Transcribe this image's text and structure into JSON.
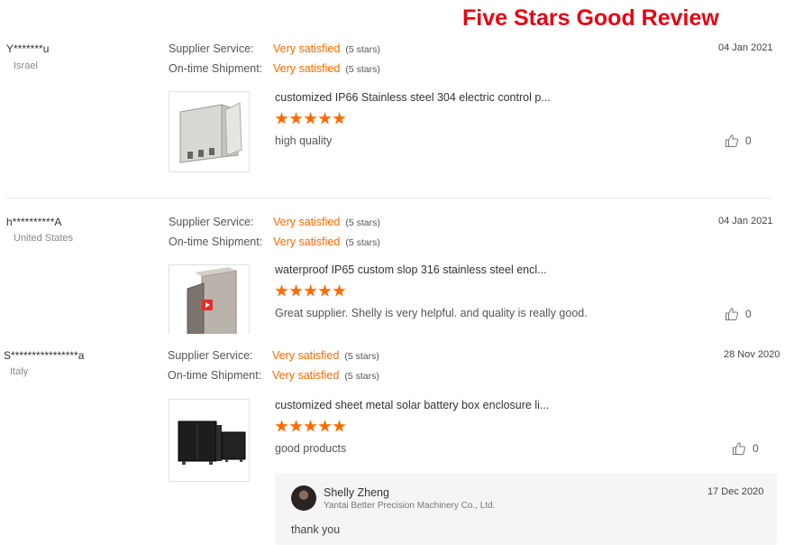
{
  "banner": "Five Stars Good Review",
  "reviews": [
    {
      "user": "Y*******u",
      "country": "Israel",
      "supplier_label": "Supplier Service:",
      "supplier_value": "Very satisfied",
      "supplier_stars": "(5 stars)",
      "shipment_label": "On-time Shipment:",
      "shipment_value": "Very satisfied",
      "shipment_stars": "(5 stars)",
      "date": "04 Jan 2021",
      "product_title": "customized IP66 Stainless steel 304 electric control p...",
      "rating": 5,
      "comment": "high quality",
      "likes": "0"
    },
    {
      "user": "h**********A",
      "country": "United States",
      "supplier_label": "Supplier Service:",
      "supplier_value": "Very satisfied",
      "supplier_stars": "(5 stars)",
      "shipment_label": "On-time Shipment:",
      "shipment_value": "Very satisfied",
      "shipment_stars": "(5 stars)",
      "date": "04 Jan 2021",
      "product_title": "waterproof IP65 custom slop 316 stainless steel encl...",
      "rating": 5,
      "comment": "Great supplier. Shelly is very helpful. and quality is really good.",
      "likes": "0"
    },
    {
      "user": "S****************a",
      "country": "Italy",
      "supplier_label": "Supplier Service:",
      "supplier_value": "Very satisfied",
      "supplier_stars": "(5 stars)",
      "shipment_label": "On-time Shipment:",
      "shipment_value": "Very satisfied",
      "shipment_stars": "(5 stars)",
      "date": "28 Nov 2020",
      "product_title": "customized sheet metal solar battery box enclosure li...",
      "rating": 5,
      "comment": "good products",
      "likes": "0",
      "reply": {
        "name": "Shelly Zheng",
        "company": "Yantai Better Precision Machinery Co., Ltd.",
        "date": "17 Dec 2020",
        "text": "thank you"
      }
    }
  ],
  "colors": {
    "accent": "#ff6a00",
    "banner": "#e30613"
  },
  "icons": {
    "like": "thumbs-up-icon",
    "play": "play-icon"
  }
}
